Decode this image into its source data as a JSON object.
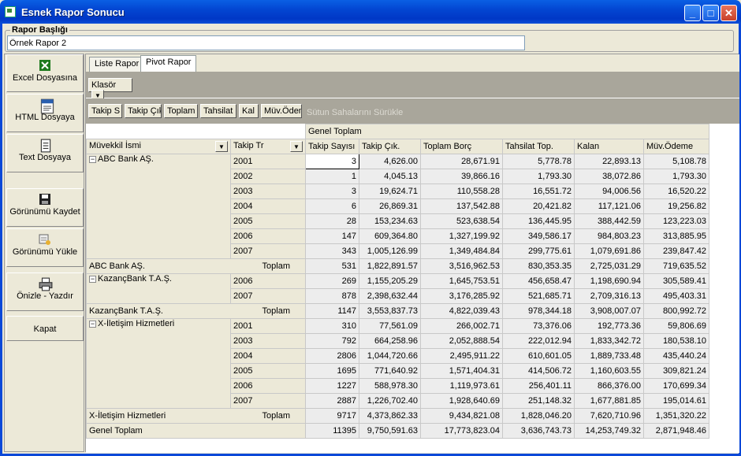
{
  "window": {
    "title": "Esnek Rapor Sonucu"
  },
  "report": {
    "legend": "Rapor Başlığı",
    "title_value": "Örnek Rapor 2"
  },
  "left_buttons": [
    {
      "label": "Excel Dosyasına",
      "icon": "excel-icon"
    },
    {
      "label": "HTML Dosyaya",
      "icon": "html-file-icon"
    },
    {
      "label": "Text Dosyaya",
      "icon": "text-file-icon"
    },
    {
      "label": "Görünümü Kaydet",
      "icon": "floppy-disk-icon"
    },
    {
      "label": "Görünümü Yükle",
      "icon": "load-view-icon"
    },
    {
      "label": "Önizle - Yazdır",
      "icon": "printer-icon"
    },
    {
      "label": "Kapat",
      "icon": ""
    }
  ],
  "tabs": [
    {
      "label": "Liste Rapor"
    },
    {
      "label": "Pivot Rapor"
    }
  ],
  "filter": {
    "field": "Klasör"
  },
  "data_fields": [
    "Takip S",
    "Takip Çık",
    "Toplam",
    "Tahsilat",
    "Kal",
    "Müv.Ödem"
  ],
  "column_hint": "Sütun Sahalarını Sürükle",
  "row_fields": [
    "Müvekkil İsmi",
    "Takip Tr"
  ],
  "grand_total_header": "Genel Toplam",
  "columns": [
    "Takip Sayısı",
    "Takip Çık.",
    "Toplam Borç",
    "Tahsilat Top.",
    "Kalan",
    "Müv.Ödeme"
  ],
  "groups": [
    {
      "name": "ABC Bank AŞ.",
      "rows": [
        {
          "year": "2001",
          "v": [
            "3",
            "4,626.00",
            "28,671.91",
            "5,778.78",
            "22,893.13",
            "5,108.78"
          ]
        },
        {
          "year": "2002",
          "v": [
            "1",
            "4,045.13",
            "39,866.16",
            "1,793.30",
            "38,072.86",
            "1,793.30"
          ]
        },
        {
          "year": "2003",
          "v": [
            "3",
            "19,624.71",
            "110,558.28",
            "16,551.72",
            "94,006.56",
            "16,520.22"
          ]
        },
        {
          "year": "2004",
          "v": [
            "6",
            "26,869.31",
            "137,542.88",
            "20,421.82",
            "117,121.06",
            "19,256.82"
          ]
        },
        {
          "year": "2005",
          "v": [
            "28",
            "153,234.63",
            "523,638.54",
            "136,445.95",
            "388,442.59",
            "123,223.03"
          ]
        },
        {
          "year": "2006",
          "v": [
            "147",
            "609,364.80",
            "1,327,199.92",
            "349,586.17",
            "984,803.23",
            "313,885.95"
          ]
        },
        {
          "year": "2007",
          "v": [
            "343",
            "1,005,126.99",
            "1,349,484.84",
            "299,775.61",
            "1,079,691.86",
            "239,847.42"
          ]
        }
      ],
      "total_label": "Toplam",
      "total": [
        "531",
        "1,822,891.57",
        "3,516,962.53",
        "830,353.35",
        "2,725,031.29",
        "719,635.52"
      ]
    },
    {
      "name": "KazançBank T.A.Ş.",
      "rows": [
        {
          "year": "2006",
          "v": [
            "269",
            "1,155,205.29",
            "1,645,753.51",
            "456,658.47",
            "1,198,690.94",
            "305,589.41"
          ]
        },
        {
          "year": "2007",
          "v": [
            "878",
            "2,398,632.44",
            "3,176,285.92",
            "521,685.71",
            "2,709,316.13",
            "495,403.31"
          ]
        }
      ],
      "total_label": "Toplam",
      "total": [
        "1147",
        "3,553,837.73",
        "4,822,039.43",
        "978,344.18",
        "3,908,007.07",
        "800,992.72"
      ]
    },
    {
      "name": "X-İletişim Hizmetleri",
      "rows": [
        {
          "year": "2001",
          "v": [
            "310",
            "77,561.09",
            "266,002.71",
            "73,376.06",
            "192,773.36",
            "59,806.69"
          ]
        },
        {
          "year": "2003",
          "v": [
            "792",
            "664,258.96",
            "2,052,888.54",
            "222,012.94",
            "1,833,342.72",
            "180,538.10"
          ]
        },
        {
          "year": "2004",
          "v": [
            "2806",
            "1,044,720.66",
            "2,495,911.22",
            "610,601.05",
            "1,889,733.48",
            "435,440.24"
          ]
        },
        {
          "year": "2005",
          "v": [
            "1695",
            "771,640.92",
            "1,571,404.31",
            "414,506.72",
            "1,160,603.55",
            "309,821.24"
          ]
        },
        {
          "year": "2006",
          "v": [
            "1227",
            "588,978.30",
            "1,119,973.61",
            "256,401.11",
            "866,376.00",
            "170,699.34"
          ]
        },
        {
          "year": "2007",
          "v": [
            "2887",
            "1,226,702.40",
            "1,928,640.69",
            "251,148.32",
            "1,677,881.85",
            "195,014.61"
          ]
        }
      ],
      "total_label": "Toplam",
      "total": [
        "9717",
        "4,373,862.33",
        "9,434,821.08",
        "1,828,046.20",
        "7,620,710.96",
        "1,351,320.22"
      ]
    }
  ],
  "grand_total": {
    "label": "Genel Toplam",
    "v": [
      "11395",
      "9,750,591.63",
      "17,773,823.04",
      "3,636,743.73",
      "14,253,749.32",
      "2,871,948.46"
    ]
  }
}
